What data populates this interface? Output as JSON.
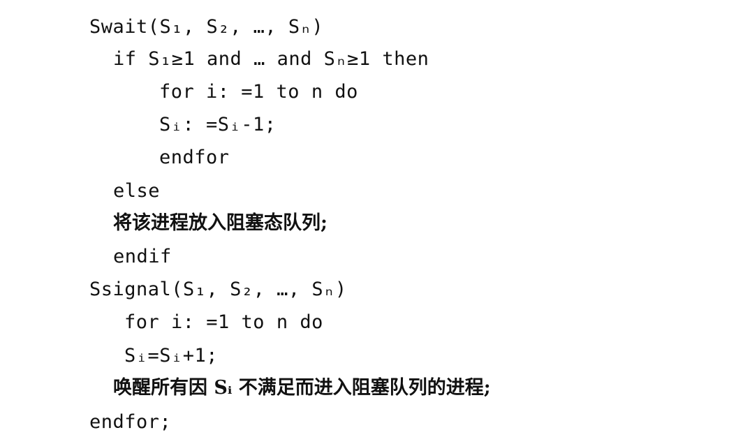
{
  "lines": [
    "Swait(S₁, S₂, …, Sₙ)",
    "if S₁≥1 and … and Sₙ≥1 then",
    "for i: =1 to n do",
    "Sᵢ: =Sᵢ-1;",
    "endfor",
    "else",
    "将该进程放入阻塞态队列;",
    "endif",
    "Ssignal(S₁, S₂, …, Sₙ)",
    "for i: =1 to n do",
    "Sᵢ=Sᵢ+1;",
    "唤醒所有因 Sᵢ 不满足而进入阻塞队列的进程;",
    "endfor;"
  ]
}
